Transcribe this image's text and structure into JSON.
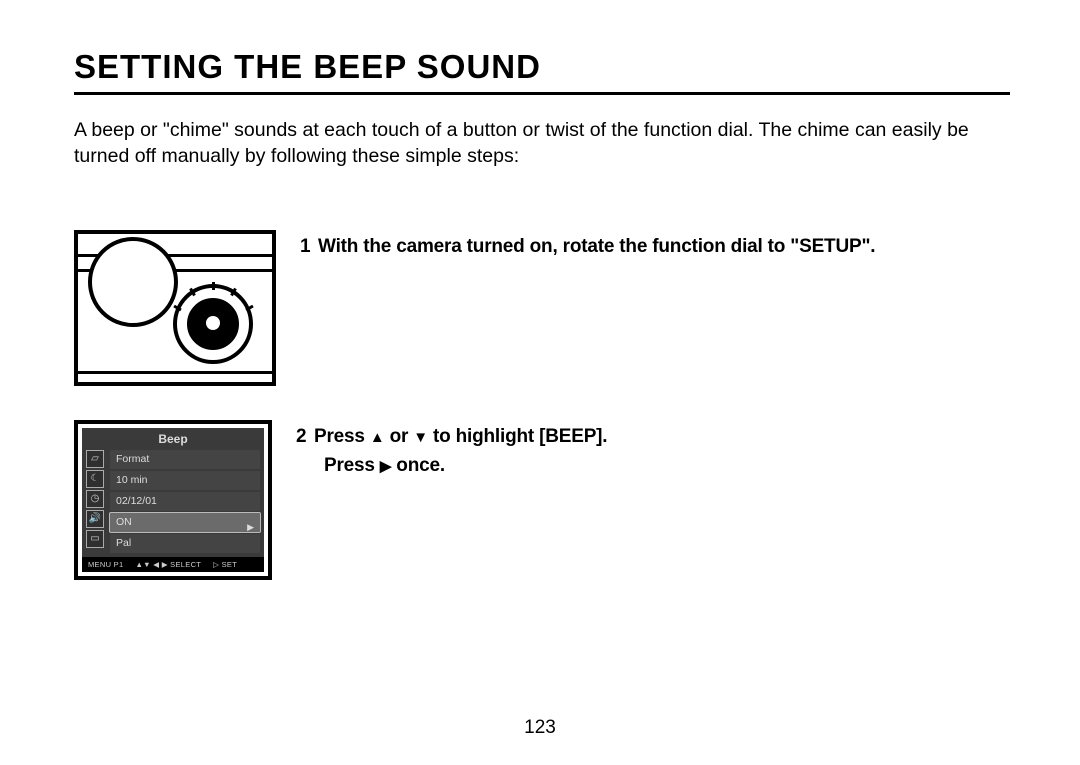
{
  "title": "SETTING THE BEEP SOUND",
  "intro": "A beep or \"chime\" sounds at each touch of a button or twist of the function dial. The chime can easily be turned off manually by following these simple steps:",
  "steps": [
    {
      "num": "1",
      "text": "With the camera turned on, rotate the function dial to \"SETUP\"."
    },
    {
      "num": "2",
      "line1_a": "Press ",
      "line1_b": " or ",
      "line1_c": " to highlight [BEEP].",
      "line2_a": "Press ",
      "line2_b": " once."
    }
  ],
  "lcd": {
    "header": "Beep",
    "items": [
      "Format",
      "10 min",
      "02/12/01",
      "ON",
      "Pal"
    ],
    "selected_index": 3,
    "footer": {
      "menu": "MENU P1",
      "select": "▲▼ ◀ ▶ SELECT",
      "set": "▷ SET"
    }
  },
  "glyphs": {
    "up": "▲",
    "down": "▼",
    "right": "▶"
  },
  "page_number": "123"
}
